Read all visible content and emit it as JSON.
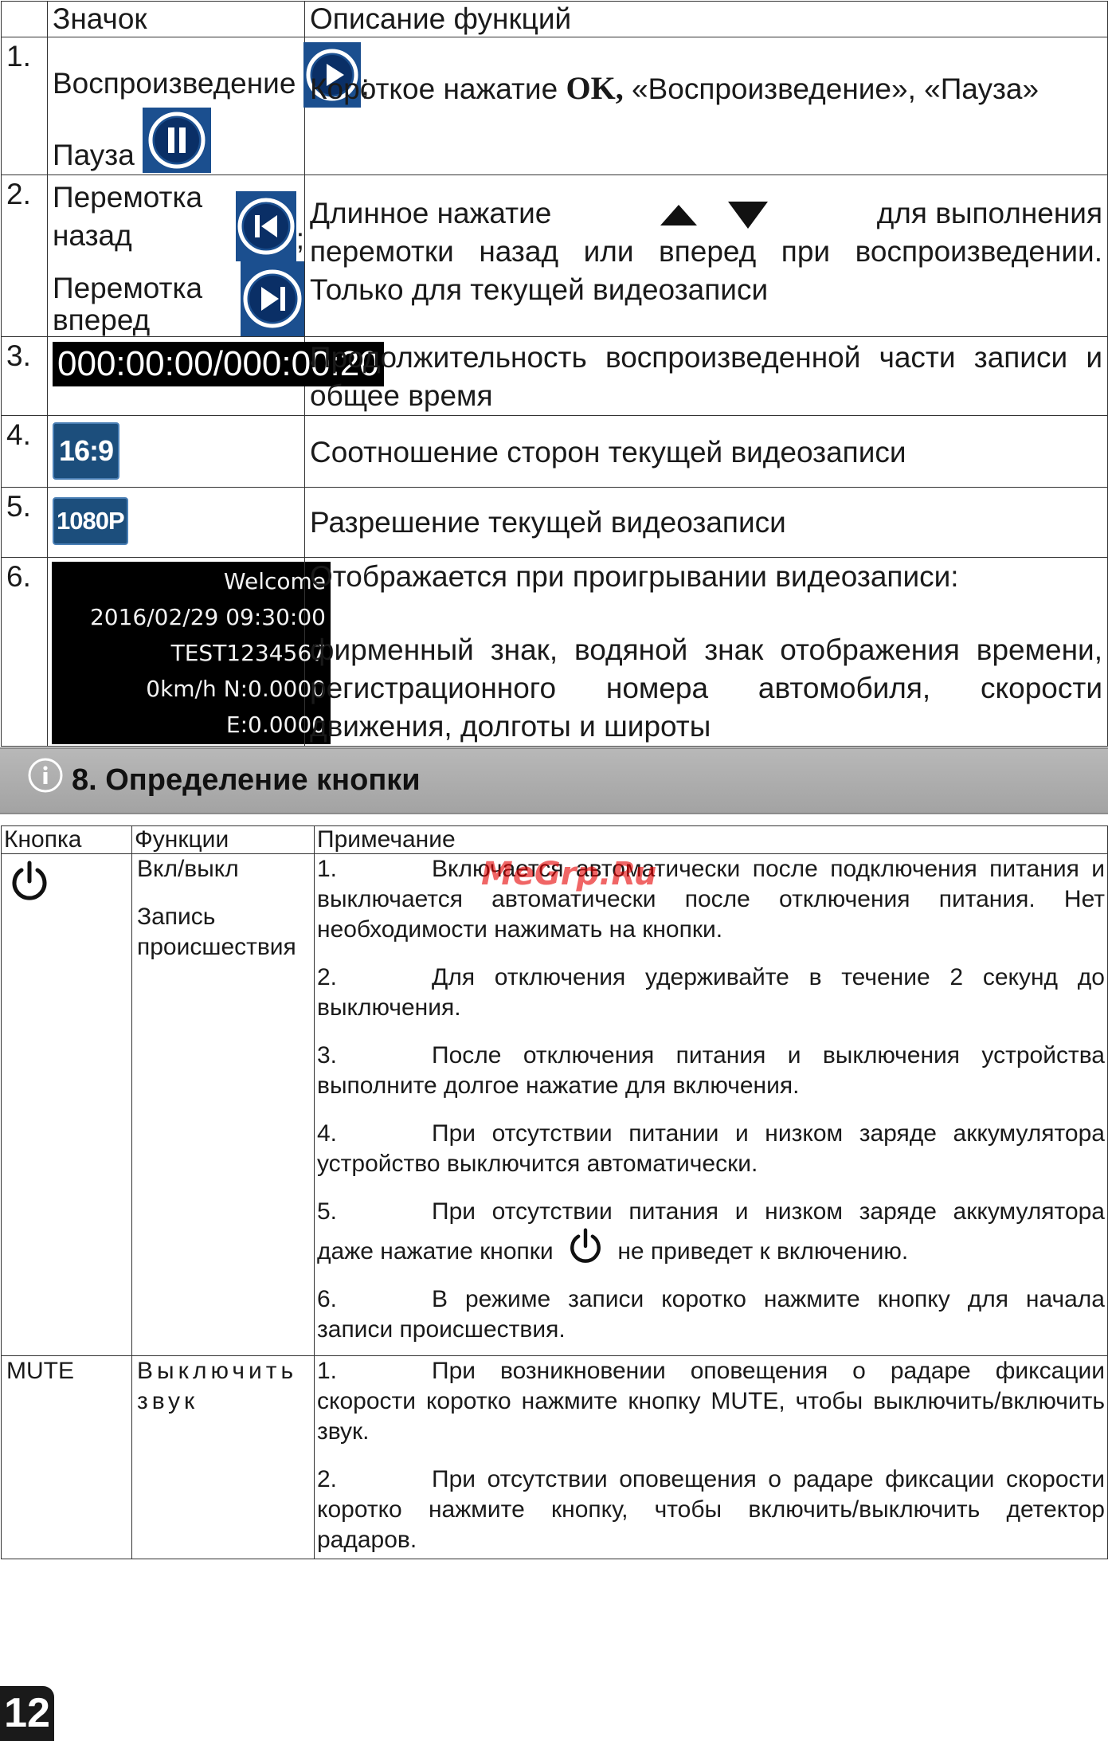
{
  "table1": {
    "headers": [
      "",
      "Значок",
      "Описание функций"
    ],
    "rows": [
      {
        "num": "1.",
        "label_a": "Воспроизведение",
        "sep": ";",
        "label_b": "Пауза",
        "icon_a": "play-icon",
        "icon_b": "pause-icon",
        "desc_pre": "Короткое нажатие ",
        "desc_bold": "OK,",
        "desc_post": " «Воспроизведение», «Пауза»"
      },
      {
        "num": "2.",
        "label_a": "Перемотка назад",
        "sep": ";",
        "label_b": "Перемотка вперед",
        "icon_a": "skip-back-icon",
        "icon_b": "skip-forward-icon",
        "desc_pre": "Длинное нажатие",
        "desc_post": "для выполнения перемотки назад или вперед при воспроизведении. Только для текущей видеозаписи"
      },
      {
        "num": "3.",
        "time": "000:00:00/000:00:20",
        "desc": "Продолжительность воспроизведенной части записи и общее время"
      },
      {
        "num": "4.",
        "chip": "16:9",
        "desc": "Соотношение сторон текущей видеозаписи"
      },
      {
        "num": "5.",
        "chip": "1080P",
        "desc": "Разрешение текущей видеозаписи"
      },
      {
        "num": "6.",
        "osd": [
          "Welcome",
          "2016/02/29 09:30:00",
          "TEST1234567",
          "0km/h N:0.0000 E:0.0000"
        ],
        "desc_a": "Отображается при проигрывании видеозаписи:",
        "desc_b": "фирменный знак, водяной знак отображения времени, регистрационного номера автомобиля, скорости движения, долготы и широты"
      }
    ]
  },
  "section": {
    "title": "8. Определение кнопки",
    "icon": "info-icon"
  },
  "table2": {
    "headers": [
      "Кнопка",
      "Функции",
      "Примечание"
    ],
    "power_row": {
      "button_icon": "power-icon",
      "functions": [
        "Вкл/выкл",
        "Запись происшествия"
      ],
      "notes": [
        {
          "n": "1.",
          "text": "Включается автоматически после подключения питания и выключается автоматически после отключения питания. Нет необходимости нажимать на кнопки."
        },
        {
          "n": "2.",
          "text": "Для отключения удерживайте в течение 2 секунд до выключения."
        },
        {
          "n": "3.",
          "text": "После отключения питания и выключения устройства выполните долгое нажатие для включения."
        },
        {
          "n": "4.",
          "text": "При отсутствии питании и низком заряде аккумулятора устройство  выключится автоматически."
        },
        {
          "n": "5.",
          "text_a": "При отсутствии питания и низком заряде аккумулятора даже нажатие кнопки",
          "text_b": "не приведет к включению."
        },
        {
          "n": "6.",
          "text": "В режиме записи коротко нажмите кнопку для начала записи происшествия."
        }
      ]
    },
    "mute_row": {
      "button": "MUTE",
      "function": "Выключить звук",
      "notes": [
        {
          "n": "1.",
          "text": "При возникновении оповещения о радаре фиксации скорости коротко нажмите кнопку MUTE, чтобы выключить/включить звук."
        },
        {
          "n": "2.",
          "text": "При отсутствии оповещения о радаре фиксации скорости коротко нажмите кнопку, чтобы включить/выключить детектор радаров."
        }
      ]
    }
  },
  "watermark": "MeGrp.Ru",
  "page_number": "12",
  "colors": {
    "icon_blue": "#1b4f8f",
    "section_gray": "#adadad",
    "watermark_red": "#e60000"
  }
}
